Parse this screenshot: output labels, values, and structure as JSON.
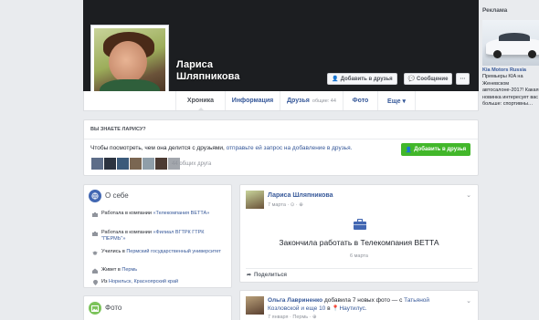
{
  "profile": {
    "name_line1": "Лариса",
    "name_line2": "Шляпникова",
    "add_friend_label": "Добавить в друзья",
    "message_label": "Сообщение",
    "more_label": "···"
  },
  "tabs": [
    {
      "label": "Хроника",
      "active": true
    },
    {
      "label": "Информация"
    },
    {
      "label": "Друзья",
      "count": "общие: 44"
    },
    {
      "label": "Фото"
    },
    {
      "label": "Еще ▾"
    }
  ],
  "know_card": {
    "title": "ВЫ ЗНАЕТЕ ЛАРИСУ?",
    "text_prefix": "Чтобы посмотреть, чем она делится с друзьями, ",
    "text_link": "отправьте ей запрос на добавление в друзья.",
    "button_label": "Добавить в друзья",
    "mutual_text": "44 общих друга",
    "thumb_colors": [
      "#5d6d88",
      "#2b3340",
      "#3b5a7a",
      "#7a6652",
      "#8f9ea9",
      "#4c3b33",
      "#a3a7ad"
    ]
  },
  "intro": {
    "title": "О себе",
    "rows": [
      {
        "prefix": "Работала в компании ",
        "link": "«Телекомпания ВЕТТА»",
        "icon": "briefcase-icon"
      },
      {
        "prefix": "Работала в компании ",
        "link": "«Филиал ВГТРК ГТРК \"ПЕРМЬ\"»",
        "icon": "briefcase-icon"
      },
      {
        "prefix": "Учились в ",
        "link": "Пермский государственный университет",
        "icon": "graduation-cap-icon"
      },
      {
        "prefix": "Живет в ",
        "link": "Пермь",
        "icon": "home-icon"
      },
      {
        "prefix": "Из ",
        "link": "Норильск, Красноярский край",
        "icon": "location-pin-icon"
      }
    ]
  },
  "photo_card": {
    "title": "Фото"
  },
  "post1": {
    "author": "Лариса Шляпникова",
    "meta": "7 марта · ⊙ · ⊕",
    "event_title": "Закончила работать в Телекомпания ВЕТТА",
    "event_date": "6 марта",
    "share_label": "Поделиться"
  },
  "post2": {
    "author": "Ольга Лавриненко",
    "action": " добавила 7 новых фото — с ",
    "with_link": "Татьяной Козловской и еще 10",
    "location_prefix": " в ",
    "location": "Наутилус.",
    "meta": "7 января · Пермь · ⊕"
  },
  "ads": {
    "title": "Реклама",
    "brand": "Kia Motors Russia",
    "text_lines": [
      "Премьеры KIA на",
      "Женевском",
      "автосалоне-2017! Какая",
      "новинка интересует вас",
      "больше: спортивны…"
    ]
  },
  "colors": {
    "brand_blue": "#4267b2",
    "link_blue": "#365899",
    "green": "#42b72a"
  }
}
